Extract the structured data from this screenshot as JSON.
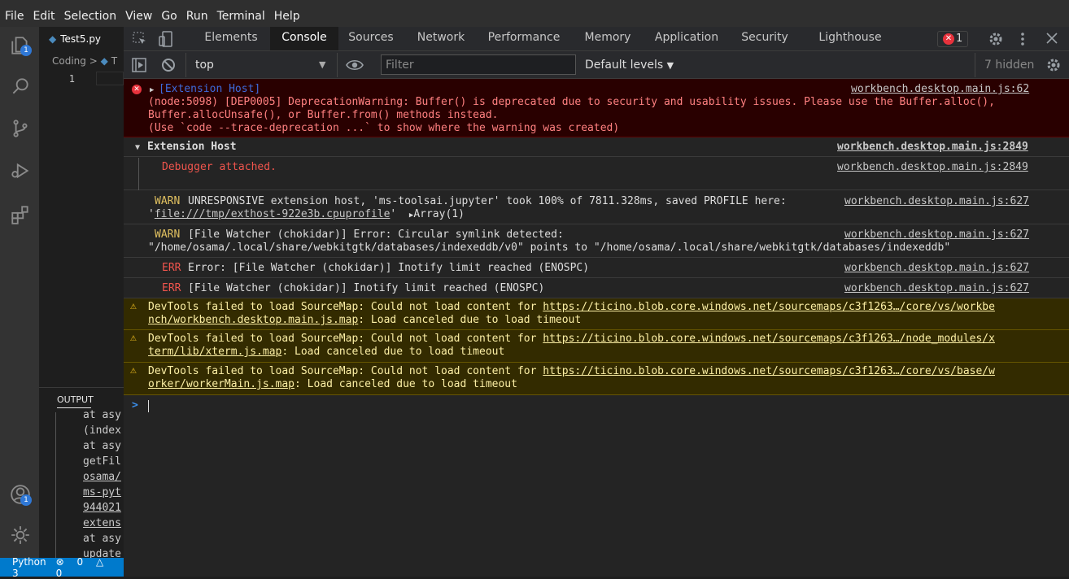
{
  "menu": [
    "File",
    "Edit",
    "Selection",
    "View",
    "Go",
    "Run",
    "Terminal",
    "Help"
  ],
  "activity": {
    "explorer_badge": "1",
    "account_badge": "1"
  },
  "editor": {
    "tab_label": "Test5.py",
    "breadcrumb_folder": "Coding",
    "breadcrumb_sep": ">",
    "breadcrumb_file": "T",
    "line_number": "1"
  },
  "panel": {
    "title": "OUTPUT",
    "lines": [
      "at asy",
      "(index",
      "at asy",
      "getFil",
      "osama/",
      "ms-pyt",
      "944021",
      "extens",
      "at asy",
      "update"
    ]
  },
  "statusbar": {
    "python": "Python 3",
    "errors": "0",
    "warnings": "0"
  },
  "devtools": {
    "tabs": [
      "Elements",
      "Console",
      "Sources",
      "Network",
      "Performance",
      "Memory",
      "Application",
      "Security",
      "Lighthouse"
    ],
    "active_tab": "Console",
    "error_count": "1",
    "context": "top",
    "filter_placeholder": "Filter",
    "levels": "Default levels",
    "hidden": "7 hidden"
  },
  "console": {
    "entries": [
      {
        "prefix": "[Extension Host]",
        "text1": "(node:5098) [DEP0005] DeprecationWarning: Buffer() is deprecated due to security and usability issues. Please use the Buffer.alloc(),",
        "text2": "Buffer.allocUnsafe(), or Buffer.from() methods instead.",
        "text3": "(Use `code --trace-deprecation ...` to show where the warning was created)",
        "source": "workbench.desktop.main.js:62"
      },
      {
        "group": "Extension Host",
        "source": "workbench.desktop.main.js:2849"
      },
      {
        "text": "Debugger attached.",
        "source": "workbench.desktop.main.js:2849"
      },
      {
        "level": "WARN",
        "text1": "UNRESPONSIVE extension host, 'ms-toolsai.jupyter' took 100% of 7811.328ms, saved PROFILE here:",
        "quote": "'",
        "link": "file:///tmp/exthost-922e3b.cpuprofile",
        "quote_end": "'",
        "array": "Array(1)",
        "source": "workbench.desktop.main.js:627"
      },
      {
        "level": "WARN",
        "text1": "[File Watcher (chokidar)] Error: Circular symlink detected:",
        "text2": "\"/home/osama/.local/share/webkitgtk/databases/indexeddb/v0\" points to \"/home/osama/.local/share/webkitgtk/databases/indexeddb\"",
        "source": "workbench.desktop.main.js:627"
      },
      {
        "level": "ERR",
        "text1": "Error: [File Watcher (chokidar)] Inotify limit reached (ENOSPC)",
        "source": "workbench.desktop.main.js:627"
      },
      {
        "level": "ERR",
        "text1": "[File Watcher (chokidar)] Inotify limit reached (ENOSPC)",
        "source": "workbench.desktop.main.js:627"
      },
      {
        "text_pre": "DevTools failed to load SourceMap: Could not load content for ",
        "link1": "https://ticino.blob.core.windows.net/sourcemaps/c3f1263…/core/vs/workbe",
        "link2": "nch/workbench.desktop.main.js.map",
        "text_post": ": Load canceled due to load timeout"
      },
      {
        "text_pre": "DevTools failed to load SourceMap: Could not load content for ",
        "link1": "https://ticino.blob.core.windows.net/sourcemaps/c3f1263…/node_modules/x",
        "link2": "term/lib/xterm.js.map",
        "text_post": ": Load canceled due to load timeout"
      },
      {
        "text_pre": "DevTools failed to load SourceMap: Could not load content for ",
        "link1": "https://ticino.blob.core.windows.net/sourcemaps/c3f1263…/core/vs/base/w",
        "link2": "orker/workerMain.js.map",
        "text_post": ": Load canceled due to load timeout"
      }
    ],
    "prompt": ">"
  },
  "colors": {
    "error_bg": "#290000",
    "warn_bg": "#332b00",
    "accent": "#007acc"
  }
}
